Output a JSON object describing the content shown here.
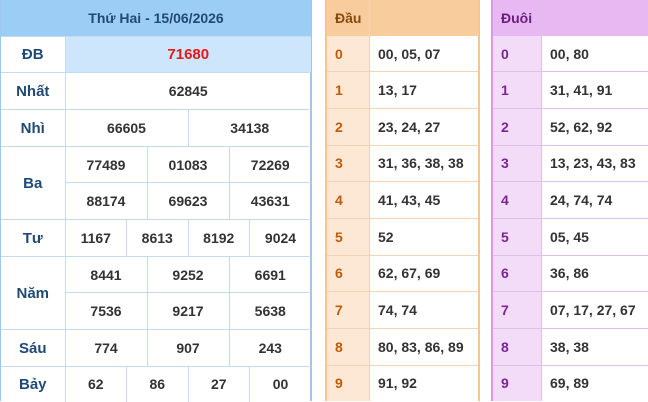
{
  "results": {
    "date_header": "Thứ Hai - 15/06/2026",
    "rows": [
      {
        "label": "ĐB",
        "values": [
          "71680"
        ]
      },
      {
        "label": "Nhất",
        "values": [
          "62845"
        ]
      },
      {
        "label": "Nhì",
        "values": [
          "66605",
          "34138"
        ]
      },
      {
        "label": "Ba",
        "values": [
          "77489",
          "01083",
          "72269",
          "88174",
          "69623",
          "43631"
        ]
      },
      {
        "label": "Tư",
        "values": [
          "1167",
          "8613",
          "8192",
          "9024"
        ]
      },
      {
        "label": "Năm",
        "values": [
          "8441",
          "9252",
          "6691",
          "7536",
          "9217",
          "5638"
        ]
      },
      {
        "label": "Sáu",
        "values": [
          "774",
          "907",
          "243"
        ]
      },
      {
        "label": "Bảy",
        "values": [
          "62",
          "86",
          "27",
          "00"
        ]
      }
    ]
  },
  "head": {
    "title": "Đầu",
    "rows": [
      {
        "key": "0",
        "value": "00, 05, 07"
      },
      {
        "key": "1",
        "value": "13, 17"
      },
      {
        "key": "2",
        "value": "23, 24, 27"
      },
      {
        "key": "3",
        "value": "31, 36, 38, 38"
      },
      {
        "key": "4",
        "value": "41, 43, 45"
      },
      {
        "key": "5",
        "value": "52"
      },
      {
        "key": "6",
        "value": "62, 67, 69"
      },
      {
        "key": "7",
        "value": "74, 74"
      },
      {
        "key": "8",
        "value": "80, 83, 86, 89"
      },
      {
        "key": "9",
        "value": "91, 92"
      }
    ]
  },
  "tail": {
    "title": "Đuôi",
    "rows": [
      {
        "key": "0",
        "value": "00, 80"
      },
      {
        "key": "1",
        "value": "31, 41, 91"
      },
      {
        "key": "2",
        "value": "52, 62, 92"
      },
      {
        "key": "3",
        "value": "13, 23, 43, 83"
      },
      {
        "key": "4",
        "value": "24, 74, 74"
      },
      {
        "key": "5",
        "value": "05, 45"
      },
      {
        "key": "6",
        "value": "36, 86"
      },
      {
        "key": "7",
        "value": "07, 17, 27, 67"
      },
      {
        "key": "8",
        "value": "38, 38"
      },
      {
        "key": "9",
        "value": "69, 89"
      }
    ]
  },
  "colors": {
    "special_prize": "#e81717",
    "results_accent": "#9ccdf5",
    "head_accent": "#f9cc9e",
    "tail_accent": "#e7b8f1"
  }
}
